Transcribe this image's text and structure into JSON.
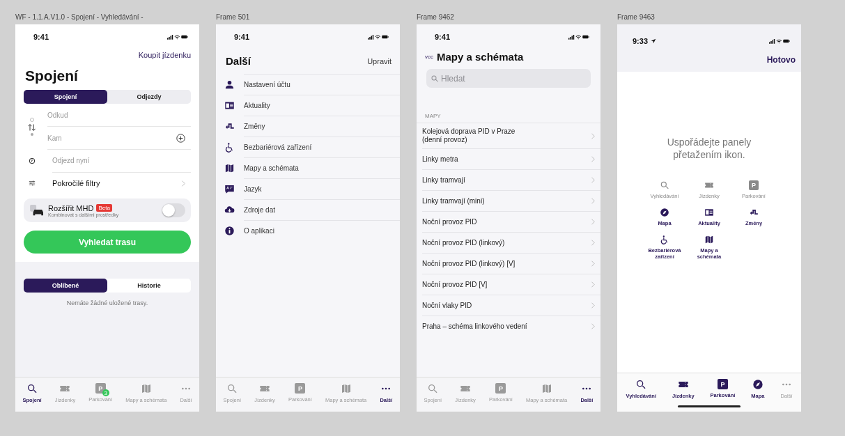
{
  "frames": [
    {
      "kind": "connections",
      "label": "WF - 1.1.A.V1.0 - Spojení - Vyhledávání -",
      "time": "9:41",
      "action": "Koupit jízdenku",
      "title": "Spojení",
      "segments": [
        {
          "label": "Spojení",
          "selected": true
        },
        {
          "label": "Odjezdy",
          "selected": false
        }
      ],
      "from_placeholder": "Odkud",
      "to_placeholder": "Kam",
      "time_placeholder": "Odjezd nyní",
      "filters": "Pokročilé filtry",
      "extend": {
        "title": "Rozšířit MHD",
        "badge": "Beta",
        "subtitle": "Kombinovat s dalšími prostředky",
        "on": false
      },
      "button": "Vyhledat trasu",
      "saved_segments": [
        {
          "label": "Oblíbené",
          "selected": true
        },
        {
          "label": "Historie",
          "selected": false
        }
      ],
      "empty": "Nemáte žádné uložené trasy.",
      "tabs": [
        {
          "label": "Spojení",
          "kind": "search",
          "selected": true
        },
        {
          "label": "Jízdenky",
          "kind": "ticket",
          "selected": false
        },
        {
          "label": "Parkování",
          "kind": "parking",
          "glyph": "P",
          "badge": "3",
          "selected": false
        },
        {
          "label": "Mapy a schémata",
          "kind": "map",
          "selected": false
        },
        {
          "label": "Další",
          "kind": "more",
          "selected": false
        }
      ]
    },
    {
      "kind": "more",
      "label": "Frame 501",
      "time": "9:41",
      "title": "Další",
      "action": "Upravit",
      "items": [
        {
          "label": "Nastavení účtu",
          "kind": "person"
        },
        {
          "label": "Aktuality",
          "kind": "news"
        },
        {
          "label": "Změny",
          "kind": "changes"
        },
        {
          "label": "Bezbariérová zařízení",
          "kind": "wheelchair"
        },
        {
          "label": "Mapy a schémata",
          "kind": "map"
        },
        {
          "label": "Jazyk",
          "kind": "language"
        },
        {
          "label": "Zdroje dat",
          "kind": "cloud"
        },
        {
          "label": "O aplikaci",
          "kind": "info"
        }
      ],
      "tabs": [
        {
          "label": "Spojení",
          "kind": "search",
          "selected": false
        },
        {
          "label": "Jízdenky",
          "kind": "ticket",
          "selected": false
        },
        {
          "label": "Parkování",
          "kind": "parking",
          "glyph": "P",
          "selected": false
        },
        {
          "label": "Mapy a schémata",
          "kind": "map",
          "selected": false
        },
        {
          "label": "Další",
          "kind": "more",
          "selected": true
        }
      ]
    },
    {
      "kind": "maps",
      "label": "Frame 9462",
      "time": "9:41",
      "back": "vcc",
      "title": "Mapy a schémata",
      "search_placeholder": "Hledat",
      "section": "MAPY",
      "items": [
        "Kolejová doprava PID v Praze (denní provoz)",
        "Linky metra",
        "Linky tramvají",
        "Linky tramvají (mini)",
        "Noční provoz PID",
        "Noční provoz PID (linkový)",
        "Noční provoz PID (linkový) [V]",
        "Noční provoz PID [V]",
        "Noční vlaky PID",
        "Praha – schéma linkového vedení"
      ],
      "tabs": [
        {
          "label": "Spojení",
          "kind": "search",
          "selected": false
        },
        {
          "label": "Jízdenky",
          "kind": "ticket",
          "selected": false
        },
        {
          "label": "Parkování",
          "kind": "parking",
          "glyph": "P",
          "selected": false
        },
        {
          "label": "Mapy a schémata",
          "kind": "map",
          "selected": false
        },
        {
          "label": "Další",
          "kind": "more",
          "selected": true
        }
      ]
    },
    {
      "kind": "arrange",
      "label": "Frame 9463",
      "time": "9:33",
      "action": "Hotovo",
      "hint": "Uspořádejte panely přetažením ikon.",
      "panels": [
        {
          "label": "Vyhledávání",
          "kind": "search",
          "active": false
        },
        {
          "label": "Jízdenky",
          "kind": "ticket",
          "active": false
        },
        {
          "label": "Parkování",
          "kind": "parking",
          "glyph": "P",
          "active": false
        },
        {
          "label": "Mapa",
          "kind": "compass",
          "active": true
        },
        {
          "label": "Aktuality",
          "kind": "news",
          "active": true
        },
        {
          "label": "Změny",
          "kind": "changes",
          "active": true
        },
        {
          "label": "Bezbariérová zařízení",
          "kind": "wheelchair",
          "active": true
        },
        {
          "label": "Mapy a schémata",
          "kind": "map",
          "active": true
        }
      ],
      "tabs": [
        {
          "label": "Vyhledávání",
          "kind": "search",
          "selected": true
        },
        {
          "label": "Jízdenky",
          "kind": "ticket",
          "selected": true
        },
        {
          "label": "Parkování",
          "kind": "parking",
          "glyph": "P",
          "selected": true
        },
        {
          "label": "Mapa",
          "kind": "compass",
          "selected": true
        },
        {
          "label": "Další",
          "kind": "more",
          "selected": false
        }
      ]
    }
  ]
}
